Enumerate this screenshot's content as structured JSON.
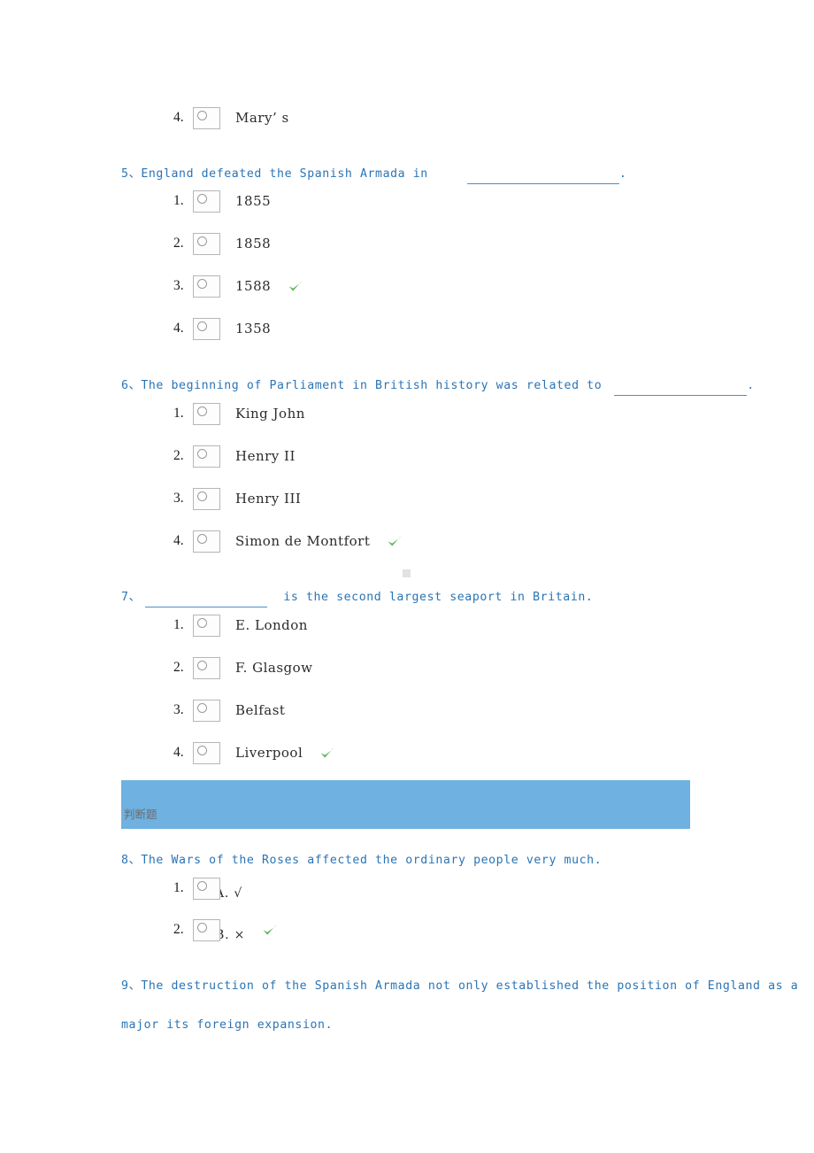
{
  "page": {
    "background": "#ffffff",
    "accent_blue": "#2a74b5",
    "banner_blue": "#6fb1e0",
    "check_green": "#5cb85c"
  },
  "orphan_option": {
    "index": "4.",
    "label": "Mary’ s"
  },
  "questions": [
    {
      "number": "5、",
      "text_before": "England defeated the Spanish Armada in",
      "text_after": ".",
      "has_blank": true,
      "options": [
        {
          "index": "1.",
          "label": "1855",
          "correct": false
        },
        {
          "index": "2.",
          "label": "1858",
          "correct": false
        },
        {
          "index": "3.",
          "label": "1588",
          "correct": true
        },
        {
          "index": "4.",
          "label": "1358",
          "correct": false
        }
      ]
    },
    {
      "number": "6、",
      "text_before": "The beginning of Parliament in British history was related to",
      "text_after": ".",
      "has_blank": true,
      "options": [
        {
          "index": "1.",
          "label": "King John",
          "correct": false
        },
        {
          "index": "2.",
          "label": "Henry II",
          "correct": false
        },
        {
          "index": "3.",
          "label": "Henry III",
          "correct": false
        },
        {
          "index": "4.",
          "label": "Simon de Montfort",
          "correct": true
        }
      ]
    },
    {
      "number": "7、",
      "text_before": "",
      "text_after": "is the second largest seaport in Britain.",
      "has_blank": true,
      "options": [
        {
          "index": "1.",
          "label": "E. London",
          "correct": false
        },
        {
          "index": "2.",
          "label": "F. Glasgow",
          "correct": false
        },
        {
          "index": "3.",
          "label": "Belfast",
          "correct": false
        },
        {
          "index": "4.",
          "label": "Liverpool",
          "correct": true
        }
      ]
    },
    {
      "number": "8、",
      "text_before": "The Wars of the Roses affected the ordinary people very much.",
      "text_after": "",
      "has_blank": false,
      "options": [
        {
          "index": "1.",
          "label": "A. √",
          "correct": false
        },
        {
          "index": "2.",
          "label": "B. ×",
          "correct": true
        }
      ]
    },
    {
      "number": "9、",
      "text_before": "The destruction of the Spanish Armada not only established the position of England as a major its foreign expansion.",
      "text_after": "",
      "has_blank": false,
      "options": []
    }
  ],
  "section_banner": {
    "label": "判断题"
  }
}
